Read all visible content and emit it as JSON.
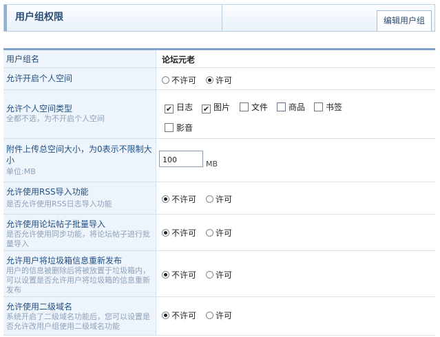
{
  "header": {
    "title": "用户组权限",
    "tab": "编辑用户组"
  },
  "table": {
    "head_label": "用户组名",
    "head_value": "论坛元老",
    "rows": [
      {
        "title": "允许开启个人空间",
        "desc": "",
        "options": [
          "不许可",
          "许可"
        ],
        "selected": "许可"
      },
      {
        "title": "允许个人空间类型",
        "desc": "全都不选，为不开启个人空间",
        "checkboxes": [
          {
            "label": "日志",
            "checked": true
          },
          {
            "label": "图片",
            "checked": true
          },
          {
            "label": "文件",
            "checked": false
          },
          {
            "label": "商品",
            "checked": false
          },
          {
            "label": "书签",
            "checked": false
          },
          {
            "label": "影音",
            "checked": false
          }
        ]
      },
      {
        "title": "附件上传总空间大小，为0表示不限制大小",
        "desc": "单位:MB",
        "input_value": "100",
        "unit": "MB"
      },
      {
        "title": "允许使用RSS导入功能",
        "desc": "是否允许使用RSS日志导入功能",
        "options": [
          "不许可",
          "许可"
        ],
        "selected": "不许可"
      },
      {
        "title": "允许使用论坛帖子批量导入",
        "desc": "是否允许使用同步功能，将论坛帖子进行批量导入",
        "options": [
          "不许可",
          "许可"
        ],
        "selected": "不许可"
      },
      {
        "title": "允许用户将垃圾箱信息重新发布",
        "desc": "用户的信息被删除后将被放置于垃圾箱内，可以设置是否允许用户将垃圾箱的信息重新发布",
        "options": [
          "不许可",
          "许可"
        ],
        "selected": "不许可"
      },
      {
        "title": "允许使用二级域名",
        "desc": "系统开启了二级域名功能后，您可以设置是否允许改用户组使用二级域名功能",
        "options": [
          "不许可",
          "许可"
        ],
        "selected": "不许可"
      }
    ]
  }
}
